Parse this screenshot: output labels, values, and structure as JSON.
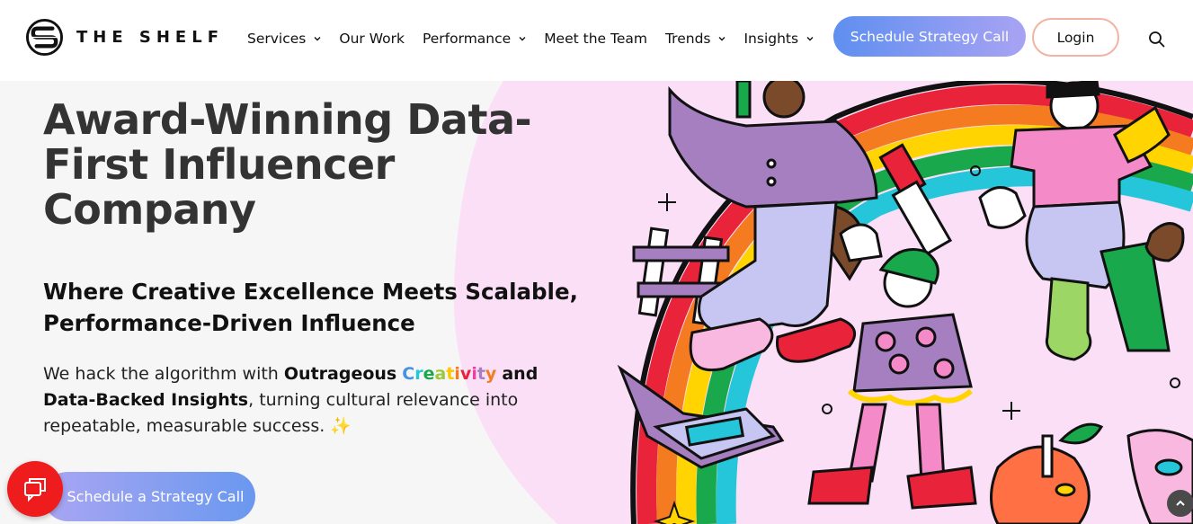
{
  "brand": {
    "name": "THE SHELF",
    "logo_icon": "shelf-s-logo-icon"
  },
  "nav": {
    "items": [
      {
        "label": "Services",
        "has_dropdown": true
      },
      {
        "label": "Our Work",
        "has_dropdown": false
      },
      {
        "label": "Performance",
        "has_dropdown": true
      },
      {
        "label": "Meet the Team",
        "has_dropdown": false
      },
      {
        "label": "Trends",
        "has_dropdown": true
      },
      {
        "label": "Insights",
        "has_dropdown": true
      }
    ],
    "cta_label": "Schedule Strategy Call",
    "login_label": "Login",
    "search_icon": "search-icon"
  },
  "hero": {
    "headline": "Award-Winning Data-First Influencer Company",
    "subheadline": "Where Creative Excellence Meets Scalable, Performance-Driven Influence",
    "body": {
      "prefix": "We hack the algorithm with ",
      "bold1": "Outrageous",
      "rainbow_word": [
        "C",
        "r",
        "e",
        "a",
        "t",
        "i",
        "v",
        "i",
        "t",
        "y"
      ],
      "and_text": "and",
      "bold2": "Data-Backed Insights",
      "suffix": ", turning cultural relevance into repeatable, measurable success.",
      "emoji": "✨"
    },
    "cta_label": "Schedule a Strategy Call",
    "illustration": "rainbow-characters-illustration"
  },
  "colors": {
    "cta_gradient_start": "#5f8ff0",
    "cta_gradient_end": "#a8a3f3",
    "login_border": "#f2b3a4",
    "chat_button": "#ee1c1c",
    "hero_pink": "#fbdff7",
    "rainbow": [
      "#e8233a",
      "#f47b20",
      "#ffd400",
      "#19a84b",
      "#26c6da",
      "#6a4fc8",
      "#ec3fa4"
    ]
  },
  "widgets": {
    "chat_icon": "chat-bubble-icon",
    "scroll_top_icon": "chevron-up-icon"
  }
}
